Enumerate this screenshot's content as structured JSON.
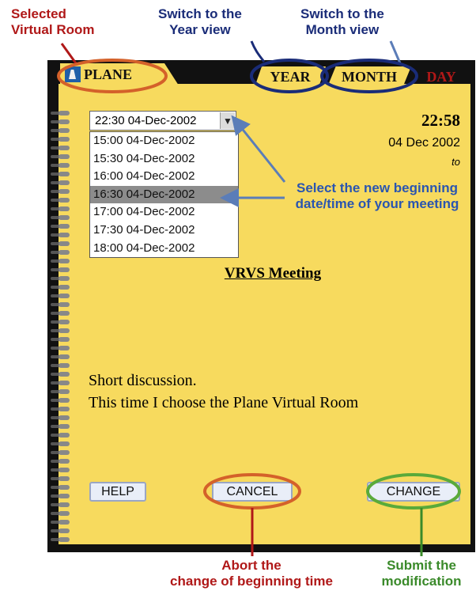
{
  "callouts": {
    "selected_room": "Selected\nVirtual Room",
    "switch_year": "Switch to the\nYear view",
    "switch_month": "Switch to the\nMonth view",
    "select_time": "Select the new beginning\ndate/time of your meeting",
    "abort": "Abort the\nchange of beginning time",
    "submit": "Submit the\nmodification"
  },
  "tabs": {
    "room": "PLANE",
    "year": "YEAR",
    "month": "MONTH",
    "day": "DAY"
  },
  "time_select": {
    "value": "22:30 04-Dec-2002",
    "options": [
      "15:00 04-Dec-2002",
      "15:30 04-Dec-2002",
      "16:00 04-Dec-2002",
      "16:30 04-Dec-2002",
      "17:00 04-Dec-2002",
      "17:30 04-Dec-2002",
      "18:00 04-Dec-2002"
    ],
    "highlighted": "16:30 04-Dec-2002"
  },
  "meeting": {
    "end_time": "22:58",
    "end_date": "04 Dec 2002",
    "to_label": "to",
    "title": "VRVS Meeting",
    "description_line1": "Short discussion.",
    "description_line2": "This time I choose the Plane Virtual Room"
  },
  "buttons": {
    "help": "HELP",
    "cancel": "CANCEL",
    "change": "CHANGE"
  },
  "colors": {
    "page": "#f7da5e",
    "callout_red": "#b01818",
    "callout_navy": "#1a2c78",
    "callout_green": "#3a8a2a"
  }
}
